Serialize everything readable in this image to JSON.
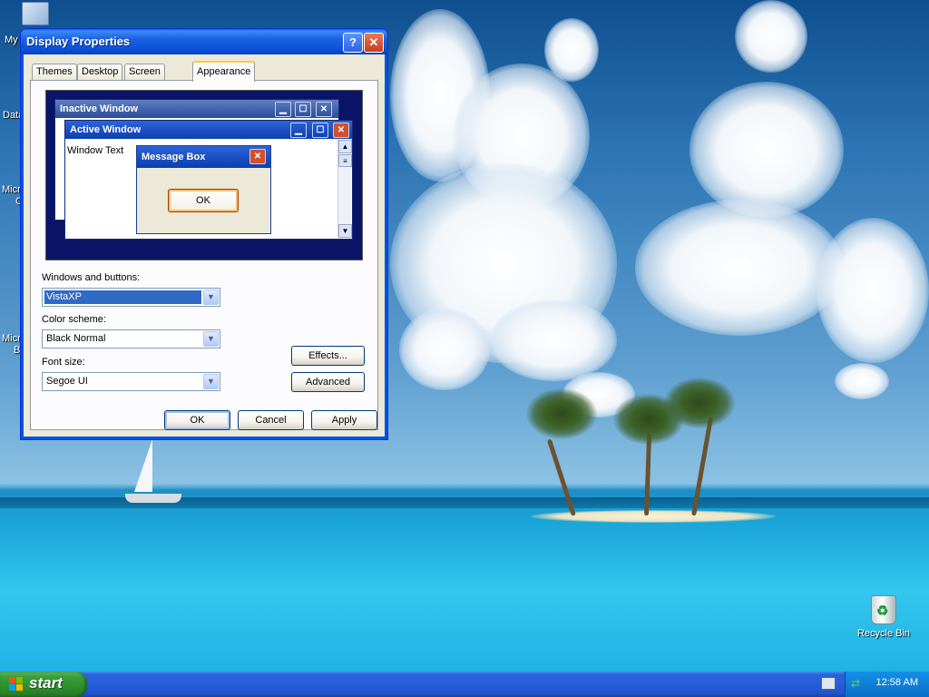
{
  "desktop": {
    "icons": {
      "my_computer_fragment": "My",
      "data_fragment": "Data",
      "micro_fragment_1": "Micro",
      "micro_fragment_1b": "C",
      "micro_fragment_2": "Micro",
      "micro_fragment_2b": "B",
      "recycle_bin": "Recycle Bin"
    }
  },
  "window": {
    "title": "Display Properties",
    "help_glyph": "?",
    "close_glyph": "✕",
    "tabs": [
      {
        "label": "Themes"
      },
      {
        "label": "Desktop"
      },
      {
        "label": "Screen Saver"
      },
      {
        "label": "Appearance"
      }
    ],
    "active_tab": "Appearance",
    "preview": {
      "inactive_title": "Inactive Window",
      "active_title": "Active Window",
      "window_text": "Window Text",
      "message_title": "Message Box",
      "ok_label": "OK",
      "min_glyph": "▁",
      "max_glyph": "☐",
      "close_glyph": "✕"
    },
    "fields": {
      "windows_buttons_label": "Windows and buttons:",
      "windows_buttons_value": "VistaXP",
      "color_scheme_label": "Color scheme:",
      "color_scheme_value": "Black Normal",
      "font_size_label": "Font size:",
      "font_size_value": "Segoe UI",
      "dropdown_glyph": "▼"
    },
    "buttons": {
      "effects": "Effects...",
      "advanced": "Advanced",
      "ok": "OK",
      "cancel": "Cancel",
      "apply": "Apply"
    }
  },
  "taskbar": {
    "start_label": "start",
    "clock": "12:58 AM",
    "net_glyph": "⇄"
  },
  "colors": {
    "title_blue": "#0c50d8",
    "close_red": "#c73d1d",
    "start_green": "#3a9d3a",
    "taskbar_blue": "#245edb",
    "tray_blue": "#0f7fd8"
  }
}
